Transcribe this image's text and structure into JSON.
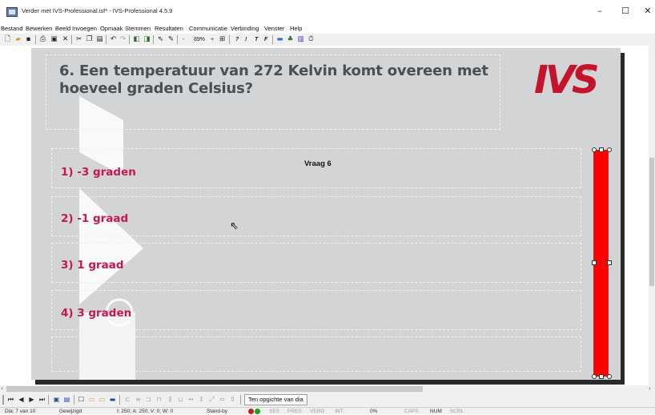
{
  "window": {
    "title": "Verder met IVS-Professional.isf* - IVS-Professional 4.5.9",
    "minimize_glyph": "–",
    "maximize_glyph": "☐",
    "close_glyph": "✕"
  },
  "menu": [
    "Bestand",
    "Bewerken",
    "Beeld",
    "Invoegen",
    "Opmaak",
    "Stemmen",
    "Resultaten",
    "Communicatie",
    "Verbinding",
    "Venster",
    "Help"
  ],
  "toolbar": {
    "zoom_minus": "-",
    "zoom_value": "89%",
    "zoom_plus": "+",
    "format_buttons": [
      "?",
      "!",
      "T",
      "F"
    ]
  },
  "slide": {
    "question": "6. Een temperatuur van 272 Kelvin komt overeen met hoeveel graden Celsius?",
    "logo_text": "IVS",
    "logo_reg": "®",
    "vraag_label": "Vraag 6",
    "answers": [
      "1) -3 graden",
      "2) -1 graad",
      "3) 1 graad",
      "4) 3 graden"
    ],
    "result_bar_color": "#ff0000",
    "accent_color": "#c8174f"
  },
  "bottom": {
    "nav": [
      "⏮",
      "◀",
      "▶",
      "⏭"
    ],
    "overview_button": "Ten opgichte van dia"
  },
  "status": {
    "dia": "Dia: 7 van 10",
    "state": "Gewijzigd",
    "counts": "I: 250; A: 250; V: 0; W: 0",
    "standby": "Stand-by",
    "ses": "SES",
    "pres": "PRES",
    "verg": "VERG",
    "int": "INT",
    "percent": "0%",
    "caps": "CAPS",
    "num": "NUM",
    "scrl": "SCRL"
  }
}
